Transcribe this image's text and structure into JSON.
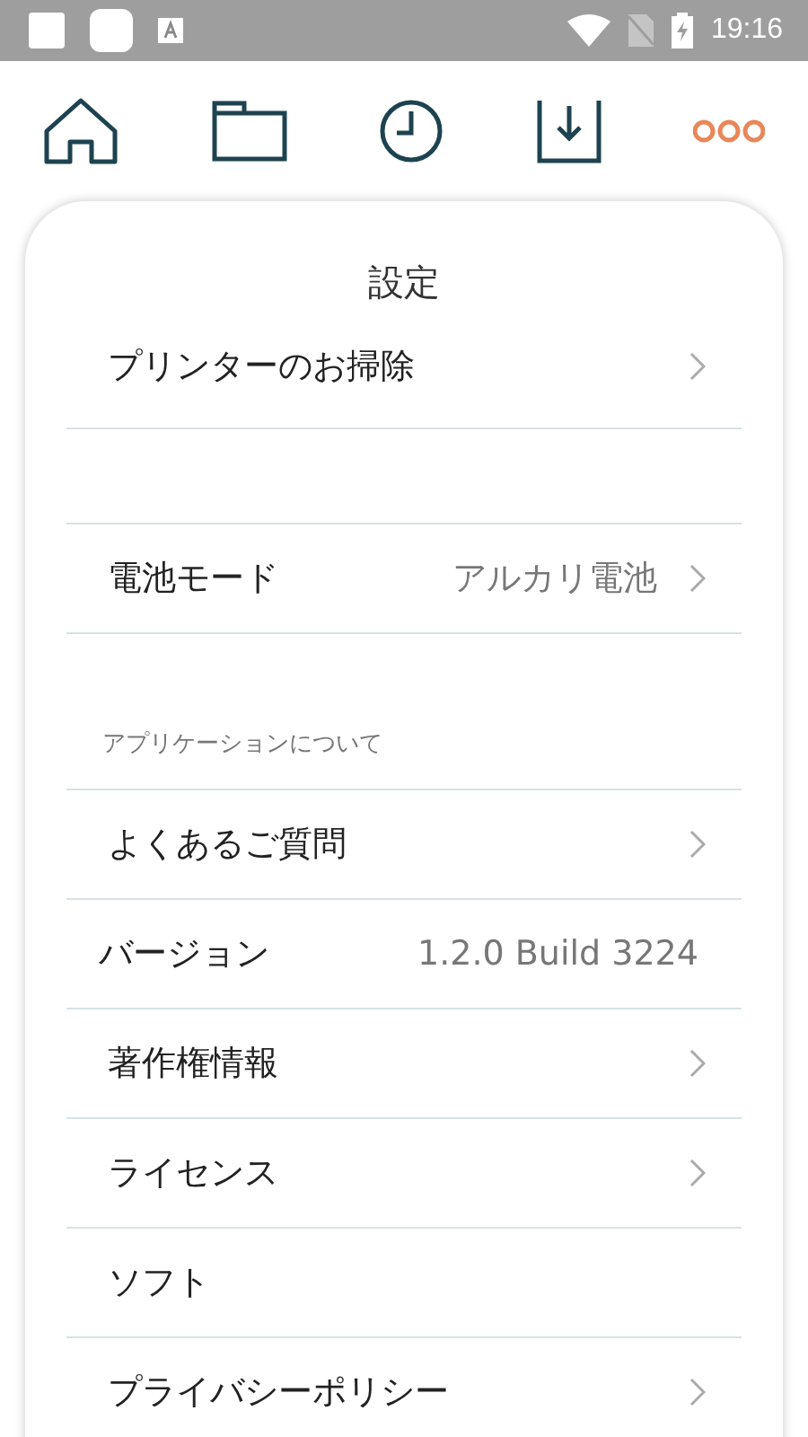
{
  "status_bar": {
    "time": "19:16"
  },
  "title": "設定",
  "sections": [
    {
      "rows": [
        {
          "label": "プリンターのお掃除",
          "chevron": true
        }
      ]
    },
    {
      "rows": [
        {
          "label": "電池モード",
          "value": "アルカリ電池",
          "chevron": true
        }
      ]
    },
    {
      "header": "アプリケーションについて",
      "rows": [
        {
          "label": "よくあるご質問",
          "chevron": true
        },
        {
          "label": "バージョン",
          "value": "1.2.0 Build 3224",
          "chevron": false
        },
        {
          "label": "著作権情報",
          "chevron": true
        },
        {
          "label": "ライセンス",
          "chevron": true
        },
        {
          "label": "ソフト",
          "chevron": false
        },
        {
          "label": "プライバシーポリシー",
          "chevron": true
        }
      ]
    }
  ]
}
